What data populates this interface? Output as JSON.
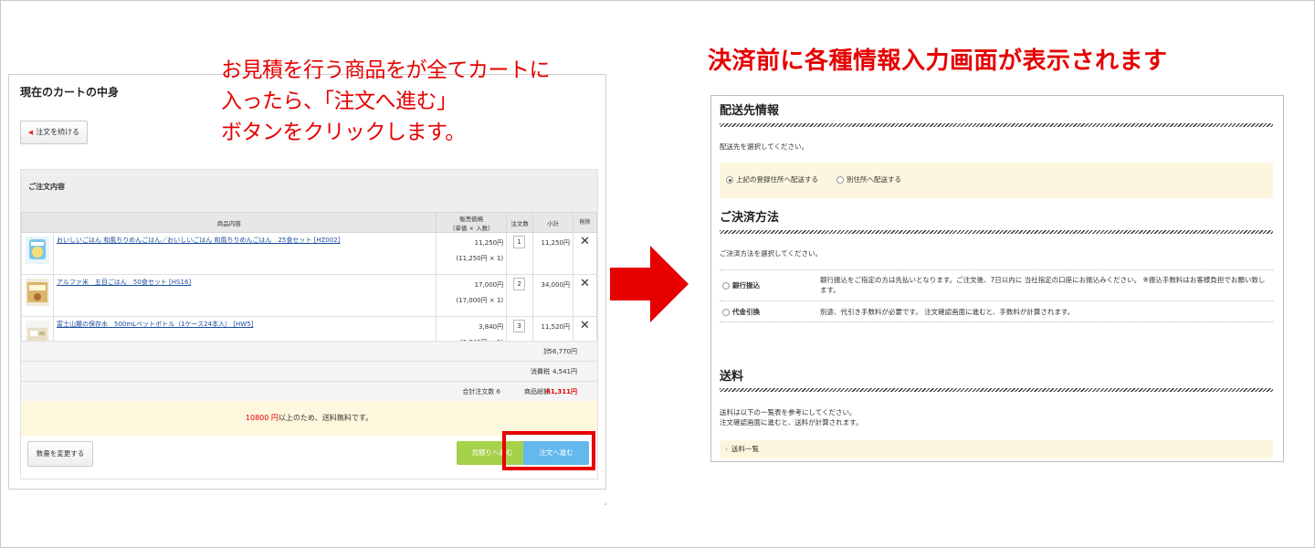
{
  "annotations": {
    "left_lines": [
      "お見積を行う商品をが全てカートに",
      "入ったら、「注文へ進む」",
      "ボタンをクリックします。"
    ],
    "right": "決済前に各種情報入力画面が表示されます"
  },
  "colors": {
    "accent_red": "#e60000",
    "estimate_green": "#a6d14a",
    "order_blue": "#63b8ec",
    "note_bg": "#fdf7dd"
  },
  "cart": {
    "title": "現在のカートの中身",
    "continue_button": "注文を続ける",
    "order_section_title": "ご注文内容",
    "headers": {
      "product": "商品内容",
      "price_line1": "販売価格",
      "price_line2": "（単価 × 入数）",
      "qty": "注文数",
      "subtotal": "小計",
      "delete": "削除"
    },
    "items": [
      {
        "name": "おいしいごはん 和風ちりめんごはん／おいしいごはん 和風ちりめんごはん　25食セット [HZ002]",
        "price": "11,250円",
        "unit": "(11,250円 × 1)",
        "qty": "1",
        "subtotal": "11,250円",
        "thumb": "rice-pouch"
      },
      {
        "name": "アルファ米　五目ごはん　50食セット [HS16]",
        "price": "17,000円",
        "unit": "(17,000円 × 1)",
        "qty": "2",
        "subtotal": "34,000円",
        "thumb": "rice-box"
      },
      {
        "name": "富士山麓の保存水　500mLペットボトル（1ケース24本入） [HW5]",
        "price": "3,840円",
        "unit": "(3,840円 × 1)",
        "qty": "3",
        "subtotal": "11,520円",
        "thumb": "water-box"
      }
    ],
    "totals": {
      "sum_label": "計",
      "sum_value": "56,770円",
      "tax_label": "消費税",
      "tax_value": "4,541円",
      "count_label": "合計注文数 6",
      "grand_label": "商品総額",
      "grand_value": "61,311円"
    },
    "free_shipping": {
      "amount": "10800 円",
      "text": "以上のため、送料無料です。"
    },
    "qty_change_button": "数量を変更する",
    "estimate_button": "見積りへ進む",
    "order_button": "注文へ進む"
  },
  "checkout": {
    "delivery": {
      "title": "配送先情報",
      "prompt": "配送先を選択してください。",
      "options": [
        "上記の登録住所へ配送する",
        "別住所へ配送する"
      ],
      "selected": 0
    },
    "payment": {
      "title": "ご決済方法",
      "prompt": "ご決済方法を選択してください。",
      "methods": [
        {
          "name": "銀行振込",
          "desc": "銀行振込をご指定の方は先払いとなります。ご注文後、7日以内に 当社指定の口座にお振込みください。 ※振込手数料はお客様負担でお願い致します。"
        },
        {
          "name": "代金引換",
          "desc": "別途、代引き手数料が必要です。 注文確認画面に進むと、手数料が計算されます。"
        }
      ]
    },
    "shipping": {
      "title": "送料",
      "line1": "送料は以下の一覧表を参考にしてください。",
      "line2": "注文確認画面に進むと、送料が計算されます。",
      "list_link": "送料一覧"
    }
  }
}
